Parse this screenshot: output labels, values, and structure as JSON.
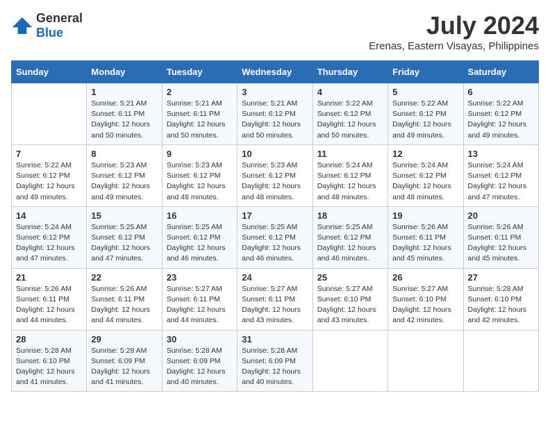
{
  "header": {
    "logo_general": "General",
    "logo_blue": "Blue",
    "month_year": "July 2024",
    "location": "Erenas, Eastern Visayas, Philippines"
  },
  "weekdays": [
    "Sunday",
    "Monday",
    "Tuesday",
    "Wednesday",
    "Thursday",
    "Friday",
    "Saturday"
  ],
  "weeks": [
    [
      {
        "day": "",
        "sunrise": "",
        "sunset": "",
        "daylight": ""
      },
      {
        "day": "1",
        "sunrise": "Sunrise: 5:21 AM",
        "sunset": "Sunset: 6:11 PM",
        "daylight": "Daylight: 12 hours and 50 minutes."
      },
      {
        "day": "2",
        "sunrise": "Sunrise: 5:21 AM",
        "sunset": "Sunset: 6:11 PM",
        "daylight": "Daylight: 12 hours and 50 minutes."
      },
      {
        "day": "3",
        "sunrise": "Sunrise: 5:21 AM",
        "sunset": "Sunset: 6:12 PM",
        "daylight": "Daylight: 12 hours and 50 minutes."
      },
      {
        "day": "4",
        "sunrise": "Sunrise: 5:22 AM",
        "sunset": "Sunset: 6:12 PM",
        "daylight": "Daylight: 12 hours and 50 minutes."
      },
      {
        "day": "5",
        "sunrise": "Sunrise: 5:22 AM",
        "sunset": "Sunset: 6:12 PM",
        "daylight": "Daylight: 12 hours and 49 minutes."
      },
      {
        "day": "6",
        "sunrise": "Sunrise: 5:22 AM",
        "sunset": "Sunset: 6:12 PM",
        "daylight": "Daylight: 12 hours and 49 minutes."
      }
    ],
    [
      {
        "day": "7",
        "sunrise": "Sunrise: 5:22 AM",
        "sunset": "Sunset: 6:12 PM",
        "daylight": "Daylight: 12 hours and 49 minutes."
      },
      {
        "day": "8",
        "sunrise": "Sunrise: 5:23 AM",
        "sunset": "Sunset: 6:12 PM",
        "daylight": "Daylight: 12 hours and 49 minutes."
      },
      {
        "day": "9",
        "sunrise": "Sunrise: 5:23 AM",
        "sunset": "Sunset: 6:12 PM",
        "daylight": "Daylight: 12 hours and 48 minutes."
      },
      {
        "day": "10",
        "sunrise": "Sunrise: 5:23 AM",
        "sunset": "Sunset: 6:12 PM",
        "daylight": "Daylight: 12 hours and 48 minutes."
      },
      {
        "day": "11",
        "sunrise": "Sunrise: 5:24 AM",
        "sunset": "Sunset: 6:12 PM",
        "daylight": "Daylight: 12 hours and 48 minutes."
      },
      {
        "day": "12",
        "sunrise": "Sunrise: 5:24 AM",
        "sunset": "Sunset: 6:12 PM",
        "daylight": "Daylight: 12 hours and 48 minutes."
      },
      {
        "day": "13",
        "sunrise": "Sunrise: 5:24 AM",
        "sunset": "Sunset: 6:12 PM",
        "daylight": "Daylight: 12 hours and 47 minutes."
      }
    ],
    [
      {
        "day": "14",
        "sunrise": "Sunrise: 5:24 AM",
        "sunset": "Sunset: 6:12 PM",
        "daylight": "Daylight: 12 hours and 47 minutes."
      },
      {
        "day": "15",
        "sunrise": "Sunrise: 5:25 AM",
        "sunset": "Sunset: 6:12 PM",
        "daylight": "Daylight: 12 hours and 47 minutes."
      },
      {
        "day": "16",
        "sunrise": "Sunrise: 5:25 AM",
        "sunset": "Sunset: 6:12 PM",
        "daylight": "Daylight: 12 hours and 46 minutes."
      },
      {
        "day": "17",
        "sunrise": "Sunrise: 5:25 AM",
        "sunset": "Sunset: 6:12 PM",
        "daylight": "Daylight: 12 hours and 46 minutes."
      },
      {
        "day": "18",
        "sunrise": "Sunrise: 5:25 AM",
        "sunset": "Sunset: 6:12 PM",
        "daylight": "Daylight: 12 hours and 46 minutes."
      },
      {
        "day": "19",
        "sunrise": "Sunrise: 5:26 AM",
        "sunset": "Sunset: 6:11 PM",
        "daylight": "Daylight: 12 hours and 45 minutes."
      },
      {
        "day": "20",
        "sunrise": "Sunrise: 5:26 AM",
        "sunset": "Sunset: 6:11 PM",
        "daylight": "Daylight: 12 hours and 45 minutes."
      }
    ],
    [
      {
        "day": "21",
        "sunrise": "Sunrise: 5:26 AM",
        "sunset": "Sunset: 6:11 PM",
        "daylight": "Daylight: 12 hours and 44 minutes."
      },
      {
        "day": "22",
        "sunrise": "Sunrise: 5:26 AM",
        "sunset": "Sunset: 6:11 PM",
        "daylight": "Daylight: 12 hours and 44 minutes."
      },
      {
        "day": "23",
        "sunrise": "Sunrise: 5:27 AM",
        "sunset": "Sunset: 6:11 PM",
        "daylight": "Daylight: 12 hours and 44 minutes."
      },
      {
        "day": "24",
        "sunrise": "Sunrise: 5:27 AM",
        "sunset": "Sunset: 6:11 PM",
        "daylight": "Daylight: 12 hours and 43 minutes."
      },
      {
        "day": "25",
        "sunrise": "Sunrise: 5:27 AM",
        "sunset": "Sunset: 6:10 PM",
        "daylight": "Daylight: 12 hours and 43 minutes."
      },
      {
        "day": "26",
        "sunrise": "Sunrise: 5:27 AM",
        "sunset": "Sunset: 6:10 PM",
        "daylight": "Daylight: 12 hours and 42 minutes."
      },
      {
        "day": "27",
        "sunrise": "Sunrise: 5:28 AM",
        "sunset": "Sunset: 6:10 PM",
        "daylight": "Daylight: 12 hours and 42 minutes."
      }
    ],
    [
      {
        "day": "28",
        "sunrise": "Sunrise: 5:28 AM",
        "sunset": "Sunset: 6:10 PM",
        "daylight": "Daylight: 12 hours and 41 minutes."
      },
      {
        "day": "29",
        "sunrise": "Sunrise: 5:28 AM",
        "sunset": "Sunset: 6:09 PM",
        "daylight": "Daylight: 12 hours and 41 minutes."
      },
      {
        "day": "30",
        "sunrise": "Sunrise: 5:28 AM",
        "sunset": "Sunset: 6:09 PM",
        "daylight": "Daylight: 12 hours and 40 minutes."
      },
      {
        "day": "31",
        "sunrise": "Sunrise: 5:28 AM",
        "sunset": "Sunset: 6:09 PM",
        "daylight": "Daylight: 12 hours and 40 minutes."
      },
      {
        "day": "",
        "sunrise": "",
        "sunset": "",
        "daylight": ""
      },
      {
        "day": "",
        "sunrise": "",
        "sunset": "",
        "daylight": ""
      },
      {
        "day": "",
        "sunrise": "",
        "sunset": "",
        "daylight": ""
      }
    ]
  ]
}
